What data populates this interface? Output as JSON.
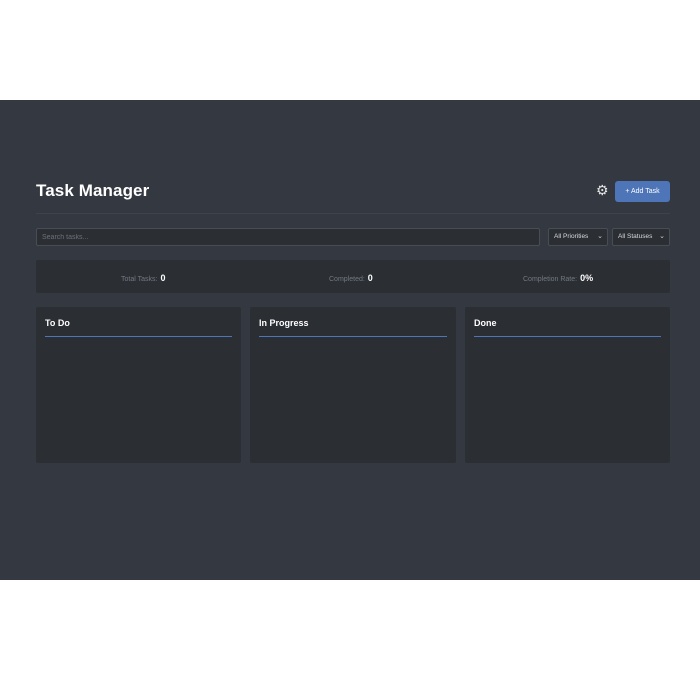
{
  "header": {
    "title": "Task Manager",
    "settings_icon": "gear-icon",
    "add_task_label": "+ Add Task"
  },
  "toolbar": {
    "search_placeholder": "Search tasks...",
    "search_value": "",
    "priority_filter": "All Priorities",
    "status_filter": "All Statuses"
  },
  "stats": {
    "total_label": "Total Tasks:",
    "total_value": "0",
    "completed_label": "Completed:",
    "completed_value": "0",
    "rate_label": "Completion Rate:",
    "rate_value": "0%"
  },
  "board": {
    "columns": [
      {
        "title": "To Do",
        "tasks": []
      },
      {
        "title": "In Progress",
        "tasks": []
      },
      {
        "title": "Done",
        "tasks": []
      }
    ]
  },
  "colors": {
    "background": "#343840",
    "panel": "#2b2e33",
    "accent": "#4d75b8",
    "text": "#ffffff",
    "muted_text": "#737982"
  }
}
